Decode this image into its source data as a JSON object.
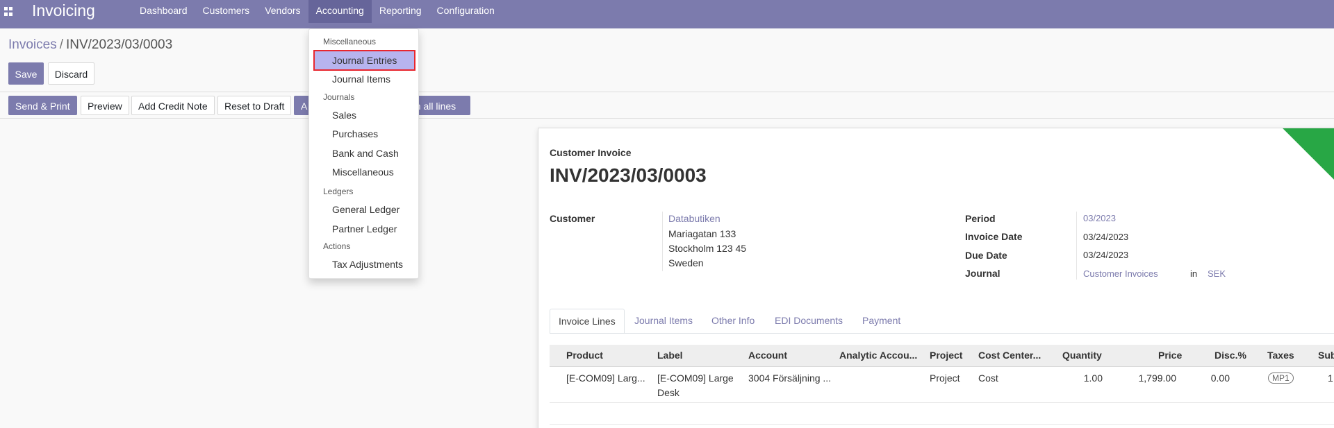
{
  "navbar": {
    "app_title": "Invoicing",
    "menu": [
      "Dashboard",
      "Customers",
      "Vendors",
      "Accounting",
      "Reporting",
      "Configuration"
    ]
  },
  "breadcrumb": {
    "parent": "Invoices",
    "separator": "/",
    "current": "INV/2023/03/0003"
  },
  "controls": {
    "save": "Save",
    "discard": "Discard"
  },
  "header_buttons": {
    "send_print": "Send & Print",
    "preview": "Preview",
    "add_credit_note": "Add Credit Note",
    "reset_to_draft": "Reset to Draft",
    "partial_a": "A",
    "partial_on_all_lines": "on all lines"
  },
  "dropdown": {
    "sections": [
      {
        "header": "Miscellaneous",
        "items": [
          "Journal Entries",
          "Journal Items"
        ]
      },
      {
        "header": "Journals",
        "items": [
          "Sales",
          "Purchases",
          "Bank and Cash",
          "Miscellaneous"
        ]
      },
      {
        "header": "Ledgers",
        "items": [
          "General Ledger",
          "Partner Ledger"
        ]
      },
      {
        "header": "Actions",
        "items": [
          "Tax Adjustments"
        ]
      }
    ]
  },
  "invoice": {
    "type_label": "Customer Invoice",
    "number": "INV/2023/03/0003",
    "customer_label": "Customer",
    "customer_name": "Databutiken",
    "address": [
      "Mariagatan 133",
      "Stockholm 123 45",
      "Sweden"
    ],
    "period_label": "Period",
    "period_value": "03/2023",
    "invoice_date_label": "Invoice Date",
    "invoice_date_value": "03/24/2023",
    "due_date_label": "Due Date",
    "due_date_value": "03/24/2023",
    "journal_label": "Journal",
    "journal_value": "Customer Invoices",
    "journal_in": "in",
    "currency": "SEK"
  },
  "tabs": [
    "Invoice Lines",
    "Journal Items",
    "Other Info",
    "EDI Documents",
    "Payment"
  ],
  "table": {
    "columns": [
      "Product",
      "Label",
      "Account",
      "Analytic Accou...",
      "Project",
      "Cost Center...",
      "Quantity",
      "Price",
      "Disc.%",
      "Taxes",
      "Sub"
    ],
    "rows": [
      {
        "product": "[E-COM09] Larg...",
        "label_line1": "[E-COM09] Large",
        "label_line2": "Desk",
        "account": "3004 Försäljning ...",
        "analytic": "",
        "project": "Project",
        "cost_center": "Cost",
        "quantity": "1.00",
        "price": "1,799.00",
        "discount": "0.00",
        "taxes": "MP1",
        "subtotal": "1"
      }
    ]
  },
  "colors": {
    "brand": "#7c7bad",
    "ribbon": "#28a745",
    "highlight_border": "#e8262e"
  }
}
